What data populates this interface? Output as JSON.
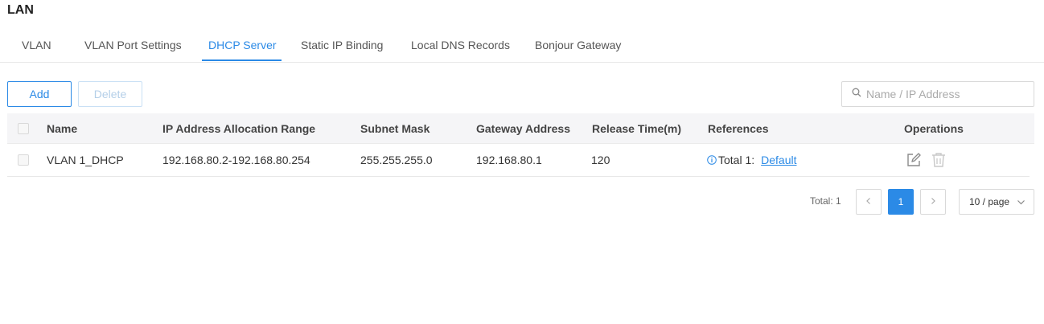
{
  "page": {
    "title": "LAN"
  },
  "tabs": [
    {
      "label": "VLAN"
    },
    {
      "label": "VLAN Port Settings"
    },
    {
      "label": "DHCP Server",
      "active": true
    },
    {
      "label": "Static IP Binding"
    },
    {
      "label": "Local DNS Records"
    },
    {
      "label": "Bonjour Gateway"
    }
  ],
  "toolbar": {
    "add_label": "Add",
    "delete_label": "Delete",
    "search_placeholder": "Name / IP Address"
  },
  "table": {
    "columns": [
      "Name",
      "IP Address Allocation Range",
      "Subnet Mask",
      "Gateway Address",
      "Release Time(m)",
      "References",
      "Operations"
    ],
    "rows": [
      {
        "name": "VLAN 1_DHCP",
        "ip_range": "192.168.80.2-192.168.80.254",
        "subnet_mask": "255.255.255.0",
        "gateway": "192.168.80.1",
        "release_time": "120",
        "references_total": "Total 1:",
        "references_link": "Default"
      }
    ]
  },
  "pagination": {
    "total_label": "Total: 1",
    "current_page": "1",
    "page_size": "10 / page"
  },
  "colors": {
    "accent": "#2b8ae6",
    "header_bg": "#f5f5f7",
    "border": "#d9d9d9"
  },
  "icons": [
    "search-icon",
    "info-icon",
    "edit-icon",
    "delete-icon",
    "chevron-left-icon",
    "chevron-right-icon",
    "chevron-down-icon"
  ]
}
